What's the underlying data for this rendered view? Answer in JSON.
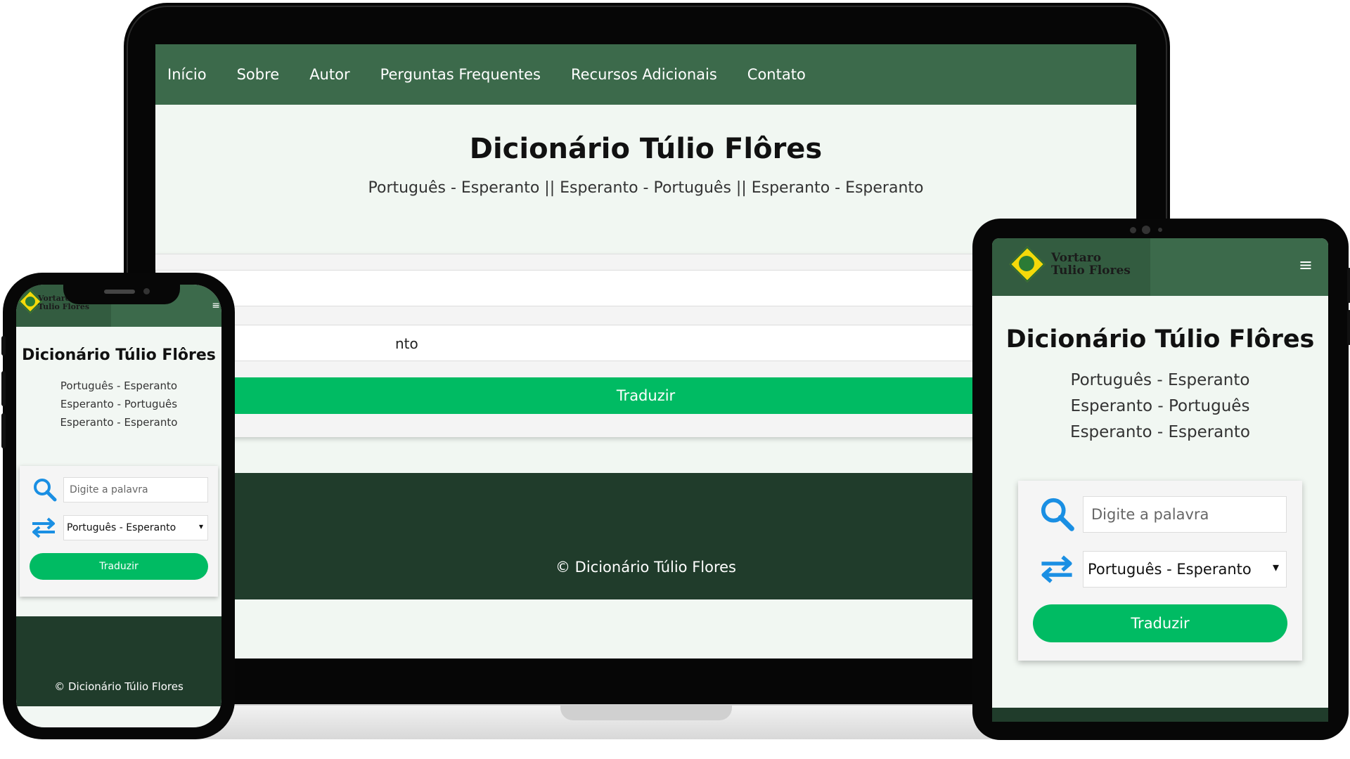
{
  "laptop": {
    "nav": [
      "Início",
      "Sobre",
      "Autor",
      "Perguntas Frequentes",
      "Recursos Adicionais",
      "Contato"
    ],
    "title": "Dicionário Túlio Flôres",
    "subtitle": "Português - Esperanto || Esperanto - Português || Esperanto - Esperanto",
    "select_partial_text": "nto",
    "button": "Traduzir",
    "footer": "© Dicionário Túlio Flores"
  },
  "phone": {
    "logo_line1": "Vortaro",
    "logo_line2": "Tulio Flores",
    "menu_icon": "≡",
    "title": "Dicionário Túlio Flôres",
    "lines": [
      "Português - Esperanto",
      "Esperanto - Português",
      "Esperanto - Esperanto"
    ],
    "search_placeholder": "Digite a palavra",
    "select_value": "Português - Esperanto",
    "button": "Traduzir",
    "footer": "© Dicionário Túlio Flores"
  },
  "tablet": {
    "logo_line1": "Vortaro",
    "logo_line2": "Tulio Flores",
    "menu_icon": "≡",
    "title": "Dicionário Túlio Flôres",
    "lines": [
      "Português - Esperanto",
      "Esperanto - Português",
      "Esperanto - Esperanto"
    ],
    "search_placeholder": "Digite a palavra",
    "select_value": "Português - Esperanto",
    "button": "Traduzir"
  },
  "colors": {
    "nav_green": "#3c6a4b",
    "footer_green": "#203c2b",
    "button_green": "#00bb63",
    "page_bg": "#f1f7f2",
    "icon_blue": "#1a8fe3"
  },
  "icons": {
    "search": "search-icon",
    "swap": "swap-arrows-icon",
    "menu": "hamburger-menu-icon",
    "chevron": "chevron-down-icon"
  }
}
